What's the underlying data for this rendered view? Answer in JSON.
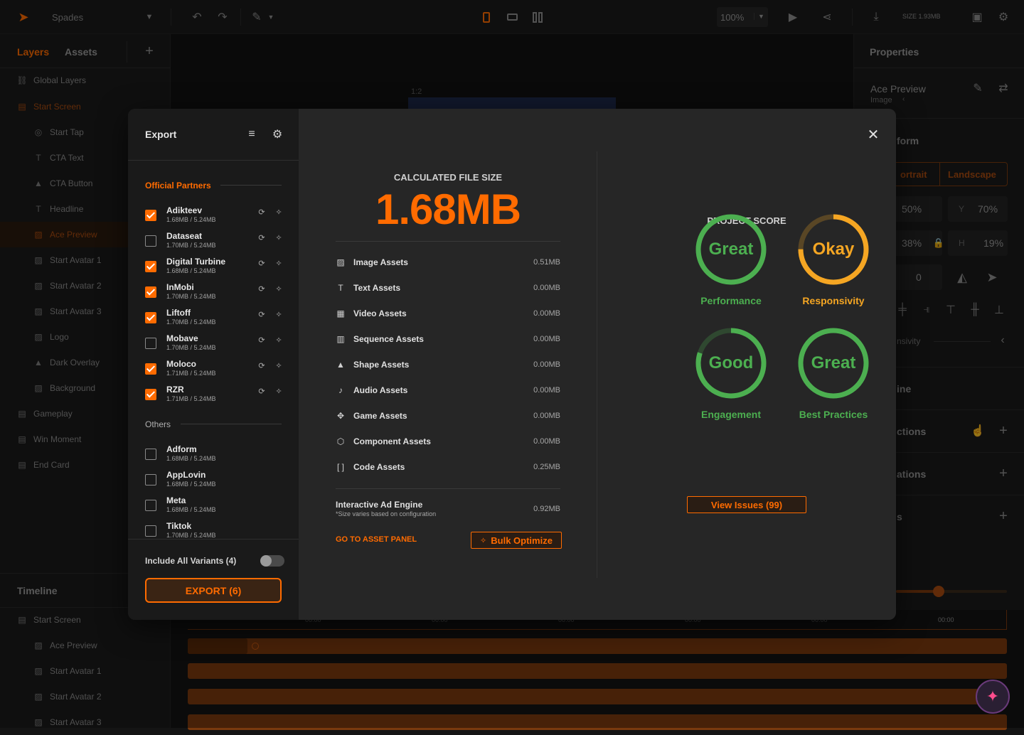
{
  "topbar": {
    "project_name": "Spades",
    "zoom": "100%",
    "size_label": "SIZE 1.93MB"
  },
  "left_panel": {
    "tabs": [
      "Layers",
      "Assets"
    ],
    "global_layers": "Global Layers",
    "layers": [
      {
        "label": "Start Screen",
        "icon": "scene-icon",
        "level": 0,
        "active": true
      },
      {
        "label": "Start Tap",
        "icon": "target-icon",
        "level": 1
      },
      {
        "label": "CTA Text",
        "icon": "text-icon",
        "level": 1
      },
      {
        "label": "CTA Button",
        "icon": "shapes-icon",
        "level": 1
      },
      {
        "label": "Headline",
        "icon": "text-icon",
        "level": 1
      },
      {
        "label": "Ace Preview",
        "icon": "image-icon",
        "level": 1,
        "selected": true
      },
      {
        "label": "Start Avatar 1",
        "icon": "image-icon",
        "level": 1
      },
      {
        "label": "Start Avatar 2",
        "icon": "image-icon",
        "level": 1
      },
      {
        "label": "Start Avatar 3",
        "icon": "image-icon",
        "level": 1
      },
      {
        "label": "Logo",
        "icon": "image-icon",
        "level": 1
      },
      {
        "label": "Dark Overlay",
        "icon": "shapes-icon",
        "level": 1
      },
      {
        "label": "Background",
        "icon": "image-icon",
        "level": 1
      },
      {
        "label": "Gameplay",
        "icon": "scene-icon",
        "level": 0
      },
      {
        "label": "Win Moment",
        "icon": "scene-icon",
        "level": 0
      },
      {
        "label": "End Card",
        "icon": "scene-icon",
        "level": 0
      }
    ],
    "timeline_title": "Timeline",
    "timeline_rows": [
      "Start Screen",
      "Ace Preview",
      "Start Avatar 1",
      "Start Avatar 2",
      "Start Avatar 3"
    ]
  },
  "canvas": {
    "ratio": "1:2"
  },
  "right_panel": {
    "title": "Properties",
    "element_name": "Ace Preview",
    "element_type": "Image",
    "transform": "form",
    "orient_portrait": "ortrait",
    "orient_landscape": "Landscape",
    "x_value": "50%",
    "y_label": "Y",
    "y_value": "70%",
    "w_value": "38%",
    "h_label": "H",
    "h_value": "19%",
    "rotation": "0",
    "responsivity": "nsivity",
    "timeline_section": "ine",
    "actions": "ctions",
    "animations": "ations",
    "effects": "s"
  },
  "timeline_ticks": [
    "00:00",
    "00:00",
    "00:00",
    "00:00",
    "00:00",
    "00:00"
  ],
  "export": {
    "title": "Export",
    "partners_title": "Official Partners",
    "partners": [
      {
        "name": "Adikteev",
        "size": "1.68MB / 5.24MB",
        "checked": true
      },
      {
        "name": "Dataseat",
        "size": "1.70MB / 5.24MB",
        "checked": false
      },
      {
        "name": "Digital Turbine",
        "size": "1.68MB / 5.24MB",
        "checked": true
      },
      {
        "name": "InMobi",
        "size": "1.70MB / 5.24MB",
        "checked": true
      },
      {
        "name": "Liftoff",
        "size": "1.70MB / 5.24MB",
        "checked": true
      },
      {
        "name": "Mobave",
        "size": "1.70MB / 5.24MB",
        "checked": false
      },
      {
        "name": "Moloco",
        "size": "1.71MB / 5.24MB",
        "checked": true
      },
      {
        "name": "RZR",
        "size": "1.71MB / 5.24MB",
        "checked": true
      }
    ],
    "others_title": "Others",
    "others": [
      {
        "name": "Adform",
        "size": "1.68MB / 5.24MB",
        "checked": false
      },
      {
        "name": "AppLovin",
        "size": "1.68MB / 5.24MB",
        "checked": false
      },
      {
        "name": "Meta",
        "size": "1.68MB / 5.24MB",
        "checked": false
      },
      {
        "name": "Tiktok",
        "size": "1.70MB / 5.24MB",
        "checked": false
      }
    ],
    "include_variants": "Include All Variants (4)",
    "include_variants_on": false,
    "export_button": "EXPORT (6)",
    "calc_title": "CALCULATED FILE SIZE",
    "calc_value": "1.68MB",
    "assets": [
      {
        "label": "Image Assets",
        "value": "0.51MB",
        "icon": "image-icon"
      },
      {
        "label": "Text Assets",
        "value": "0.00MB",
        "icon": "text-icon"
      },
      {
        "label": "Video Assets",
        "value": "0.00MB",
        "icon": "video-icon"
      },
      {
        "label": "Sequence Assets",
        "value": "0.00MB",
        "icon": "sequence-icon"
      },
      {
        "label": "Shape Assets",
        "value": "0.00MB",
        "icon": "shapes-icon"
      },
      {
        "label": "Audio Assets",
        "value": "0.00MB",
        "icon": "audio-icon"
      },
      {
        "label": "Game Assets",
        "value": "0.00MB",
        "icon": "gamepad-icon"
      },
      {
        "label": "Component Assets",
        "value": "0.00MB",
        "icon": "component-icon"
      },
      {
        "label": "Code Assets",
        "value": "0.25MB",
        "icon": "code-icon"
      }
    ],
    "engine_label": "Interactive Ad Engine",
    "engine_note": "*Size varies based on configuration",
    "engine_value": "0.92MB",
    "goto_assets": "GO TO ASSET PANEL",
    "bulk_optimize": "Bulk Optimize",
    "score_title": "PROJECT SCORE",
    "scores": [
      {
        "rating": "Great",
        "label": "Performance",
        "color": "#4caf50",
        "fill": 1.0
      },
      {
        "rating": "Okay",
        "label": "Responsivity",
        "color": "#f5a623",
        "fill": 0.75
      },
      {
        "rating": "Good",
        "label": "Engagement",
        "color": "#4caf50",
        "fill": 0.8
      },
      {
        "rating": "Great",
        "label": "Best Practices",
        "color": "#4caf50",
        "fill": 1.0
      }
    ],
    "view_issues": "View Issues (99)"
  },
  "colors": {
    "accent": "#ff6b00",
    "green": "#4caf50",
    "amber": "#f5a623"
  }
}
